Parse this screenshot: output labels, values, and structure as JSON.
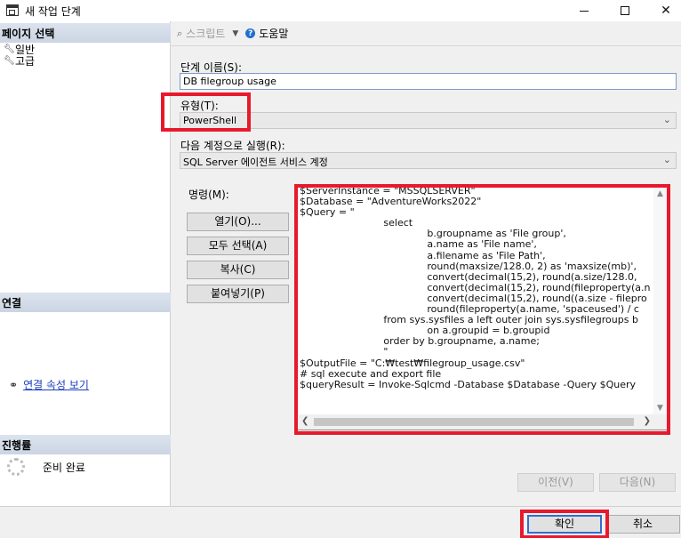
{
  "window": {
    "title": "새 작업 단계"
  },
  "left_pane": {
    "select_page_header": "페이지 선택",
    "pages": [
      {
        "label": "일반",
        "icon": "wrench-icon"
      },
      {
        "label": "고급",
        "icon": "wrench-icon"
      }
    ],
    "connection_header": "연결",
    "connection_link": "연결 속성 보기",
    "progress_header": "진행률",
    "progress_status": "준비 완료"
  },
  "toolbar": {
    "script_label": "스크립트",
    "help_label": "도움말"
  },
  "form": {
    "step_name_label": "단계 이름(S):",
    "step_name_value": "DB filegroup usage",
    "type_label": "유형(T):",
    "type_value": "PowerShell",
    "run_as_label": "다음 계정으로 실행(R):",
    "run_as_value": "SQL Server 에이전트 서비스 계정",
    "command_label": "명령(M):"
  },
  "command_buttons": {
    "open": "열기(O)...",
    "select_all": "모두 선택(A)",
    "copy": "복사(C)",
    "paste": "붙여넣기(P)"
  },
  "command_lines": [
    "$ServerInstance = \"MSSQLSERVER\"",
    "$Database = \"AdventureWorks2022\"",
    "$Query = \"",
    "                           select",
    "                                         b.groupname as 'File group',",
    "                                         a.name as 'File name',",
    "                                         a.filename as 'File Path',",
    "                                         round(maxsize/128.0, 2) as 'maxsize(mb)',",
    "                                         convert(decimal(15,2), round(a.size/128.0,",
    "                                         convert(decimal(15,2), round(fileproperty(a.n",
    "                                         convert(decimal(15,2), round((a.size - filepro",
    "                                         round(fileproperty(a.name, 'spaceused') / c",
    "                           from sys.sysfiles a left outer join sys.sysfilegroups b",
    "                                         on a.groupid = b.groupid",
    "                           order by b.groupname, a.name;",
    "                           \"",
    "",
    "$OutputFile = \"C:₩test₩filegroup_usage.csv\"",
    "",
    "",
    "# sql execute and export file",
    "$queryResult = Invoke-Sqlcmd -Database $Database -Query $Query"
  ],
  "nav_buttons": {
    "prev": "이전(V)",
    "next": "다음(N)"
  },
  "dialog_buttons": {
    "ok": "확인",
    "cancel": "취소"
  },
  "colors": {
    "annotation": "#e8192c",
    "link": "#1a3fbf",
    "section_header": "#cbd5e2"
  }
}
